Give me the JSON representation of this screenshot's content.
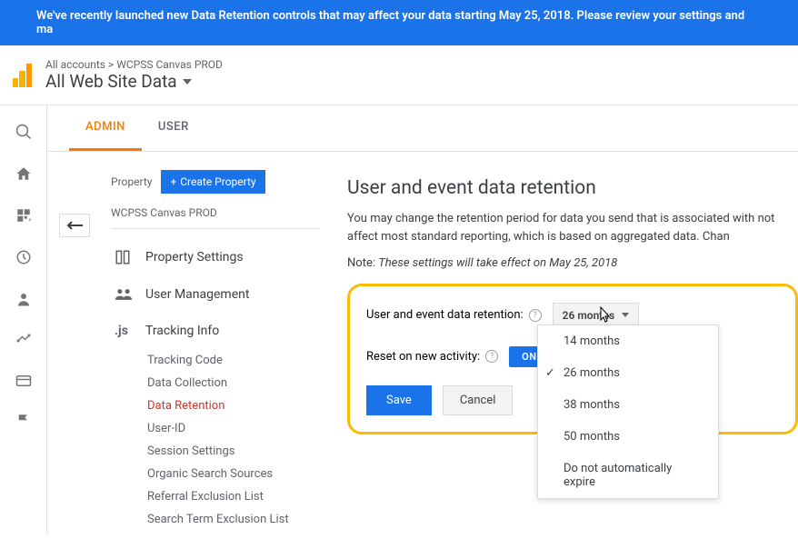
{
  "banner": "We've recently launched new Data Retention controls that may affect your data starting May 25, 2018. Please review your settings and ma",
  "breadcrumb": {
    "root": "All accounts",
    "sep": ">",
    "current": "WCPSS Canvas PROD"
  },
  "header_title": "All Web Site Data",
  "tabs": {
    "admin": "ADMIN",
    "user": "USER"
  },
  "property": {
    "label": "Property",
    "create_btn": "Create Property",
    "name": "WCPSS Canvas PROD",
    "menu": {
      "settings": "Property Settings",
      "user_mgmt": "User Management",
      "tracking": "Tracking Info"
    },
    "tracking_sub": [
      "Tracking Code",
      "Data Collection",
      "Data Retention",
      "User-ID",
      "Session Settings",
      "Organic Search Sources",
      "Referral Exclusion List",
      "Search Term Exclusion List"
    ],
    "tracking_active_index": 2,
    "js_label": ".js"
  },
  "panel": {
    "title": "User and event data retention",
    "desc": "You may change the retention period for data you send that is associated with not affect most standard reporting, which is based on aggregated data. Chan",
    "note_prefix": "Note: ",
    "note_italic": "These settings will take effect on May 25, 2018",
    "retention_label": "User and event data retention:",
    "retention_value": "26 months",
    "reset_label": "Reset on new activity:",
    "toggle_value": "ON",
    "save": "Save",
    "cancel": "Cancel",
    "options": [
      "14 months",
      "26 months",
      "38 months",
      "50 months",
      "Do not automatically expire"
    ],
    "selected_index": 1
  }
}
